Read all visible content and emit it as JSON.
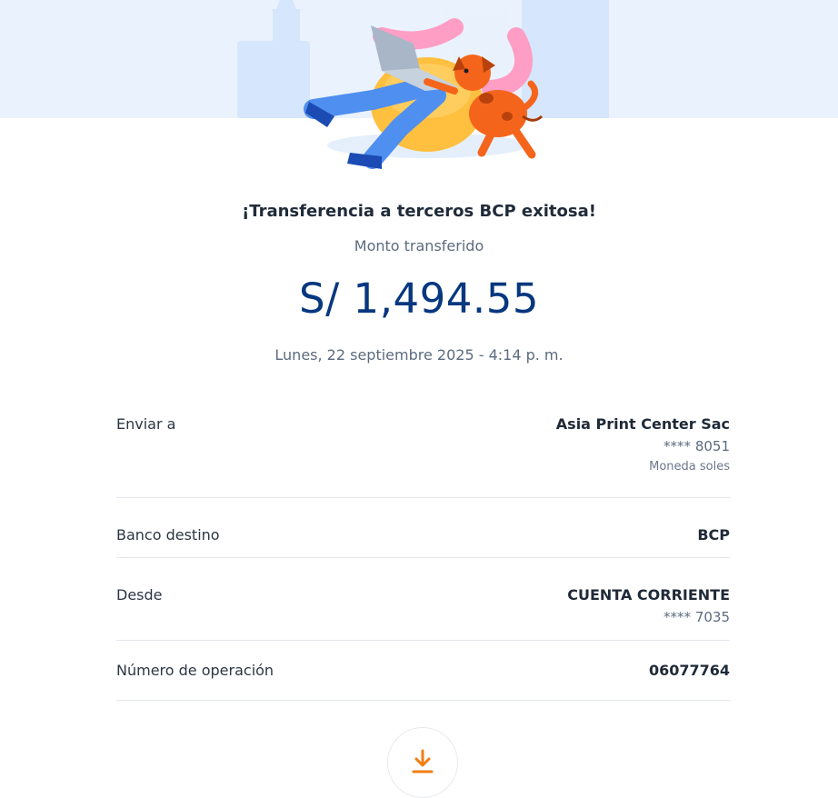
{
  "receipt": {
    "title": "¡Transferencia a terceros BCP exitosa!",
    "amount_label": "Monto transferido",
    "amount": "S/ 1,494.55",
    "datetime": "Lunes, 22 septiembre 2025 - 4:14 p. m."
  },
  "details": {
    "send_to": {
      "label": "Enviar a",
      "name": "Asia Print Center Sac",
      "account": "**** 8051",
      "currency": "Moneda soles"
    },
    "bank": {
      "label": "Banco destino",
      "value": "BCP"
    },
    "from": {
      "label": "Desde",
      "account_type": "CUENTA CORRIENTE",
      "account": "**** 7035"
    },
    "operation": {
      "label": "Número de operación",
      "value": "06077764"
    }
  },
  "actions": {
    "download_icon": "download-icon"
  },
  "colors": {
    "amount": "#06377f",
    "hero_background": "#eaf2fe",
    "download_accent": "#f07e12"
  },
  "illustration": {
    "name": "person-with-laptop-and-dog-illustration"
  }
}
